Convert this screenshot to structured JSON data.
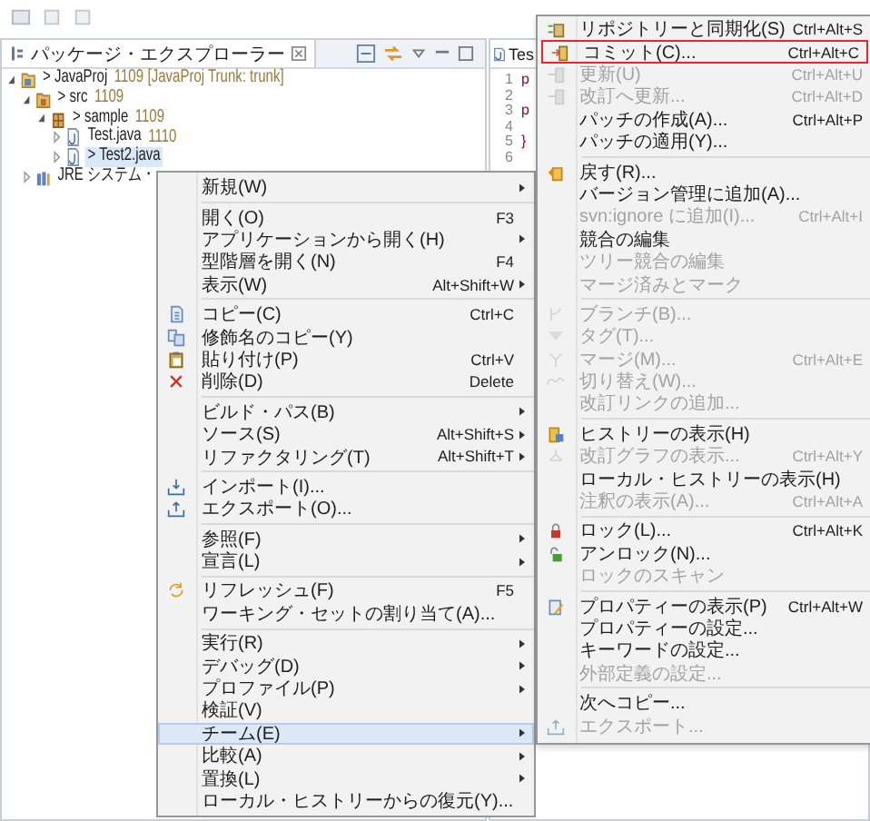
{
  "explorer": {
    "title": "パッケージ・エクスプローラー",
    "tree": [
      {
        "label": "> JavaProj",
        "revision": "1109",
        "extra": "[JavaProj Trunk: trunk]",
        "kind": "project",
        "expanded": true,
        "selected": false,
        "children": [
          {
            "label": "> src",
            "revision": "1109",
            "kind": "folder",
            "expanded": true,
            "selected": false,
            "children": [
              {
                "label": "> sample",
                "revision": "1109",
                "kind": "package",
                "expanded": true,
                "selected": false,
                "children": [
                  {
                    "label": "Test.java",
                    "revision": "1110",
                    "kind": "file",
                    "expanded": false,
                    "selected": false
                  },
                  {
                    "label": "> Test2.java",
                    "kind": "file",
                    "expanded": false,
                    "selected": true
                  }
                ]
              }
            ]
          },
          {
            "label": "JRE システム・",
            "kind": "library",
            "expanded": false,
            "selected": false
          }
        ]
      }
    ]
  },
  "editor": {
    "tab": "Tes",
    "lines": [
      {
        "number": "1",
        "code": "p"
      },
      {
        "number": "2"
      },
      {
        "number": "3",
        "code": "p"
      },
      {
        "number": "4"
      },
      {
        "number": "5",
        "code": "}"
      },
      {
        "number": "6"
      }
    ]
  },
  "context_menu": {
    "items": [
      {
        "kind": "item",
        "label": "新規(W)",
        "submenu": true,
        "selected": false
      },
      {
        "kind": "separator"
      },
      {
        "kind": "item",
        "label": "開く(O)",
        "shortcut": "F3",
        "submenu": false,
        "selected": false
      },
      {
        "kind": "item",
        "label": "アプリケーションから開く(H)",
        "submenu": true,
        "selected": false
      },
      {
        "kind": "item",
        "label": "型階層を開く(N)",
        "shortcut": "F4",
        "submenu": false,
        "selected": false
      },
      {
        "kind": "item",
        "label": "表示(W)",
        "shortcut": "Alt+Shift+W",
        "submenu": true,
        "selected": false
      },
      {
        "kind": "separator"
      },
      {
        "kind": "item",
        "label": "コピー(C)",
        "shortcut": "Ctrl+C",
        "submenu": false,
        "selected": false
      },
      {
        "kind": "item",
        "label": "修飾名のコピー(Y)",
        "submenu": false,
        "selected": false
      },
      {
        "kind": "item",
        "label": "貼り付け(P)",
        "shortcut": "Ctrl+V",
        "submenu": false,
        "selected": false
      },
      {
        "kind": "item",
        "label": "削除(D)",
        "shortcut": "Delete",
        "submenu": false,
        "selected": false
      },
      {
        "kind": "separator"
      },
      {
        "kind": "item",
        "label": "ビルド・パス(B)",
        "submenu": true,
        "selected": false
      },
      {
        "kind": "item",
        "label": "ソース(S)",
        "shortcut": "Alt+Shift+S",
        "submenu": true,
        "selected": false
      },
      {
        "kind": "item",
        "label": "リファクタリング(T)",
        "shortcut": "Alt+Shift+T",
        "submenu": true,
        "selected": false
      },
      {
        "kind": "separator"
      },
      {
        "kind": "item",
        "label": "インポート(I)...",
        "submenu": false,
        "selected": false
      },
      {
        "kind": "item",
        "label": "エクスポート(O)...",
        "submenu": false,
        "selected": false
      },
      {
        "kind": "separator"
      },
      {
        "kind": "item",
        "label": "参照(F)",
        "submenu": true,
        "selected": false
      },
      {
        "kind": "item",
        "label": "宣言(L)",
        "submenu": true,
        "selected": false
      },
      {
        "kind": "separator"
      },
      {
        "kind": "item",
        "label": "リフレッシュ(F)",
        "shortcut": "F5",
        "submenu": false,
        "selected": false
      },
      {
        "kind": "item",
        "label": "ワーキング・セットの割り当て(A)...",
        "submenu": false,
        "selected": false
      },
      {
        "kind": "separator"
      },
      {
        "kind": "item",
        "label": "実行(R)",
        "submenu": true,
        "selected": false
      },
      {
        "kind": "item",
        "label": "デバッグ(D)",
        "submenu": true,
        "selected": false
      },
      {
        "kind": "item",
        "label": "プロファイル(P)",
        "submenu": true,
        "selected": false
      },
      {
        "kind": "item",
        "label": "検証(V)",
        "submenu": false,
        "selected": false
      },
      {
        "kind": "item",
        "label": "チーム(E)",
        "submenu": true,
        "selected": true
      },
      {
        "kind": "item",
        "label": "比較(A)",
        "submenu": true,
        "selected": false
      },
      {
        "kind": "item",
        "label": "置換(L)",
        "submenu": true,
        "selected": false
      },
      {
        "kind": "item",
        "label": "ローカル・ヒストリーからの復元(Y)...",
        "submenu": false,
        "selected": false
      }
    ]
  },
  "team_menu": {
    "items": [
      {
        "kind": "item",
        "label": "リポジトリーと同期化(S)",
        "shortcut": "Ctrl+Alt+S",
        "disabled": false,
        "outlined": false
      },
      {
        "kind": "item",
        "label": "コミット(C)...",
        "shortcut": "Ctrl+Alt+C",
        "disabled": false,
        "outlined": true
      },
      {
        "kind": "item",
        "label": "更新(U)",
        "shortcut": "Ctrl+Alt+U",
        "disabled": true,
        "outlined": false
      },
      {
        "kind": "item",
        "label": "改訂へ更新...",
        "shortcut": "Ctrl+Alt+D",
        "disabled": true,
        "outlined": false
      },
      {
        "kind": "item",
        "label": "パッチの作成(A)...",
        "shortcut": "Ctrl+Alt+P",
        "disabled": false,
        "outlined": false
      },
      {
        "kind": "item",
        "label": "パッチの適用(Y)...",
        "disabled": false,
        "outlined": false
      },
      {
        "kind": "separator"
      },
      {
        "kind": "item",
        "label": "戻す(R)...",
        "disabled": false,
        "outlined": false
      },
      {
        "kind": "item",
        "label": "バージョン管理に追加(A)...",
        "disabled": false,
        "outlined": false
      },
      {
        "kind": "item",
        "label": "svn:ignore に追加(I)...",
        "shortcut": "Ctrl+Alt+I",
        "disabled": true,
        "outlined": false
      },
      {
        "kind": "item",
        "label": "競合の編集",
        "disabled": false,
        "outlined": false
      },
      {
        "kind": "item",
        "label": "ツリー競合の編集",
        "disabled": true,
        "outlined": false
      },
      {
        "kind": "item",
        "label": "マージ済みとマーク",
        "disabled": true,
        "outlined": false
      },
      {
        "kind": "separator"
      },
      {
        "kind": "item",
        "label": "ブランチ(B)...",
        "disabled": true,
        "outlined": false
      },
      {
        "kind": "item",
        "label": "タグ(T)...",
        "disabled": true,
        "outlined": false
      },
      {
        "kind": "item",
        "label": "マージ(M)...",
        "shortcut": "Ctrl+Alt+E",
        "disabled": true,
        "outlined": false
      },
      {
        "kind": "item",
        "label": "切り替え(W)...",
        "disabled": true,
        "outlined": false
      },
      {
        "kind": "item",
        "label": "改訂リンクの追加...",
        "disabled": true,
        "outlined": false
      },
      {
        "kind": "separator"
      },
      {
        "kind": "item",
        "label": "ヒストリーの表示(H)",
        "disabled": false,
        "outlined": false
      },
      {
        "kind": "item",
        "label": "改訂グラフの表示...",
        "shortcut": "Ctrl+Alt+Y",
        "disabled": true,
        "outlined": false
      },
      {
        "kind": "item",
        "label": "ローカル・ヒストリーの表示(H)",
        "disabled": false,
        "outlined": false
      },
      {
        "kind": "item",
        "label": "注釈の表示(A)...",
        "shortcut": "Ctrl+Alt+A",
        "disabled": true,
        "outlined": false
      },
      {
        "kind": "separator"
      },
      {
        "kind": "item",
        "label": "ロック(L)...",
        "shortcut": "Ctrl+Alt+K",
        "disabled": false,
        "outlined": false
      },
      {
        "kind": "item",
        "label": "アンロック(N)...",
        "disabled": false,
        "outlined": false
      },
      {
        "kind": "item",
        "label": "ロックのスキャン",
        "disabled": true,
        "outlined": false
      },
      {
        "kind": "separator"
      },
      {
        "kind": "item",
        "label": "プロパティーの表示(P)",
        "shortcut": "Ctrl+Alt+W",
        "disabled": false,
        "outlined": false
      },
      {
        "kind": "item",
        "label": "プロパティーの設定...",
        "disabled": false,
        "outlined": false
      },
      {
        "kind": "item",
        "label": "キーワードの設定...",
        "disabled": false,
        "outlined": false
      },
      {
        "kind": "item",
        "label": "外部定義の設定...",
        "disabled": true,
        "outlined": false
      },
      {
        "kind": "separator"
      },
      {
        "kind": "item",
        "label": "次へコピー...",
        "disabled": false,
        "outlined": false
      },
      {
        "kind": "item",
        "label": "エクスポート...",
        "disabled": true,
        "outlined": false
      }
    ]
  }
}
